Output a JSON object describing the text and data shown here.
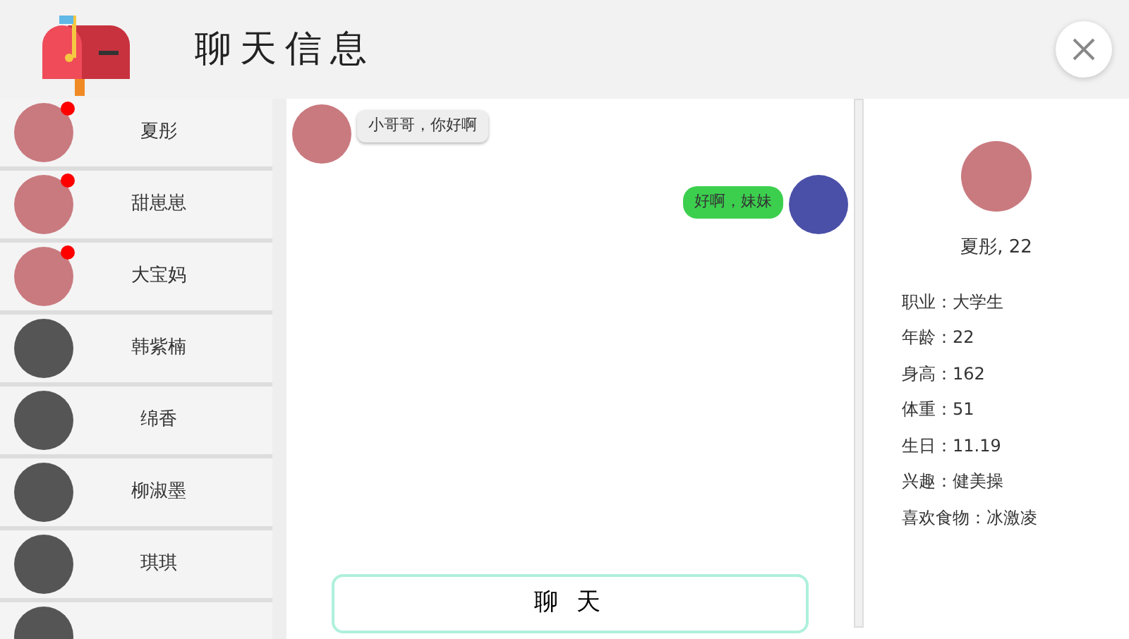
{
  "window": {
    "title": "聊天信息"
  },
  "contacts": [
    {
      "name": "夏彤",
      "unread": true
    },
    {
      "name": "甜崽崽",
      "unread": true
    },
    {
      "name": "大宝妈",
      "unread": true
    },
    {
      "name": "韩紫楠",
      "unread": false
    },
    {
      "name": "绵香",
      "unread": false
    },
    {
      "name": "柳淑墨",
      "unread": false
    },
    {
      "name": "琪琪",
      "unread": false
    },
    {
      "unread": false
    }
  ],
  "messages": [
    {
      "kind": "received",
      "text": "小哥哥，你好啊"
    },
    {
      "kind": "sent",
      "text": "好啊，妹妹"
    }
  ],
  "chat_button": "聊 天",
  "profile": {
    "name": "夏彤, 22",
    "details": [
      "职业：大学生",
      "年龄：22",
      "身高：162",
      "体重：51",
      "生日：11.19",
      "兴趣：健美操",
      "喜欢食物：冰激凌"
    ]
  }
}
